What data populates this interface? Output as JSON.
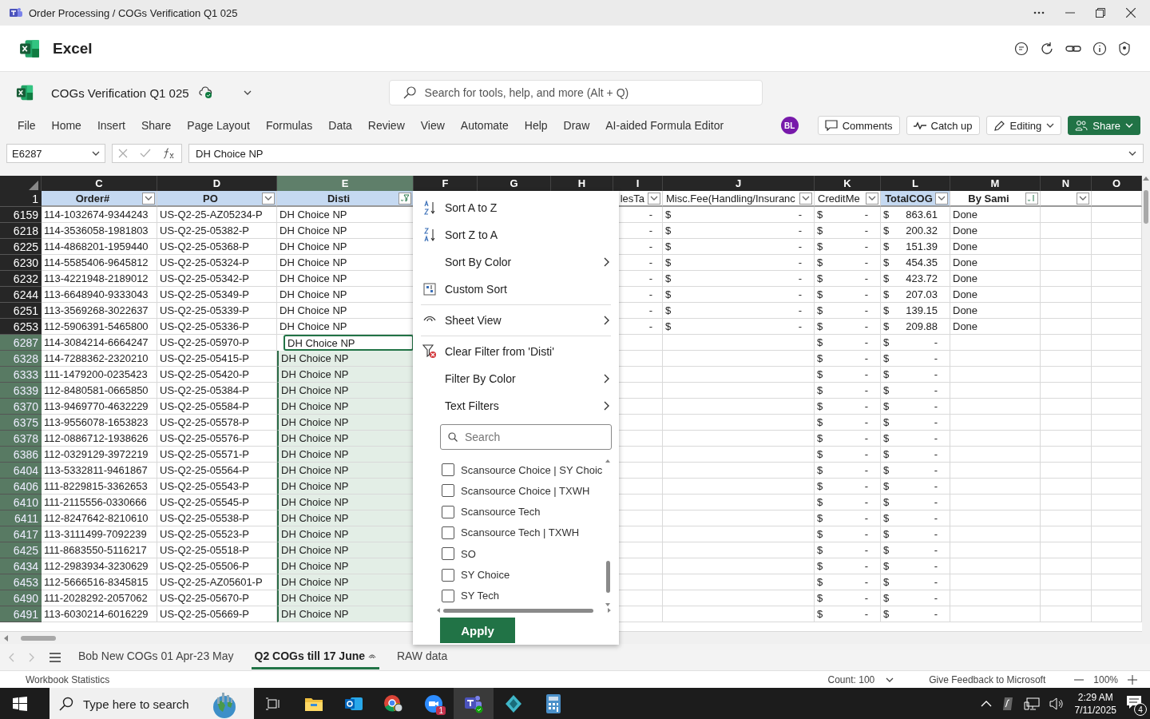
{
  "window": {
    "title": "Order Processing / COGs Verification Q1 025"
  },
  "app": {
    "name": "Excel"
  },
  "document": {
    "title": "COGs Verification Q1 025"
  },
  "search": {
    "placeholder": "Search for tools, help, and more (Alt + Q)"
  },
  "ribbon_tabs": [
    "File",
    "Home",
    "Insert",
    "Share",
    "Page Layout",
    "Formulas",
    "Data",
    "Review",
    "View",
    "Automate",
    "Help",
    "Draw",
    "AI-aided Formula Editor"
  ],
  "avatar": "BL",
  "actions": [
    {
      "kind": "comments",
      "label": "Comments"
    },
    {
      "kind": "catchup",
      "label": "Catch up"
    },
    {
      "kind": "editing",
      "label": "Editing"
    },
    {
      "kind": "share",
      "label": "Share"
    }
  ],
  "formula_bar": {
    "name_box": "E6287",
    "value": "DH Choice NP"
  },
  "header_row_number": "1",
  "columns": [
    {
      "letter": "C",
      "selected": false,
      "field": {
        "label": "Order#",
        "bold": true,
        "highlight": true,
        "kind": "dropdown"
      }
    },
    {
      "letter": "D",
      "selected": false,
      "field": {
        "label": "PO",
        "bold": true,
        "highlight": true,
        "kind": "dropdown"
      }
    },
    {
      "letter": "E",
      "selected": true,
      "field": {
        "label": "Disti",
        "bold": true,
        "highlight": true,
        "kind": "filtered"
      }
    },
    {
      "letter": "F",
      "selected": false
    },
    {
      "letter": "G",
      "selected": false
    },
    {
      "letter": "H",
      "selected": false
    },
    {
      "letter": "I",
      "selected": false,
      "field": {
        "label": "lesTa",
        "bold": false,
        "highlight": false,
        "kind": "dropdown"
      }
    },
    {
      "letter": "J",
      "selected": false,
      "field": {
        "label": "Misc.Fee(Handling/Insuranc",
        "bold": false,
        "highlight": false,
        "kind": "dropdown"
      }
    },
    {
      "letter": "K",
      "selected": false,
      "field": {
        "label": "CreditMe",
        "bold": false,
        "highlight": false,
        "kind": "dropdown"
      }
    },
    {
      "letter": "L",
      "selected": false,
      "field": {
        "label": "TotalCOG",
        "bold": true,
        "highlight": true,
        "kind": "dropdown"
      }
    },
    {
      "letter": "M",
      "selected": false,
      "field": {
        "label": "By Sami",
        "bold": true,
        "highlight": false,
        "kind": "sorted"
      }
    },
    {
      "letter": "N",
      "selected": false,
      "field": {
        "kind": "dropdown"
      }
    },
    {
      "letter": "O",
      "selected": false
    }
  ],
  "rows": [
    {
      "row": "6159",
      "selected": false,
      "active": false,
      "order": "114-1032674-9344243",
      "po": "US-Q2-25-AZ05234-P",
      "disti": "DH Choice NP",
      "i": "-",
      "j": [
        "$",
        "-"
      ],
      "k": [
        "$",
        "-"
      ],
      "l": [
        "$",
        "863.61"
      ],
      "m": "Done"
    },
    {
      "row": "6218",
      "selected": false,
      "active": false,
      "order": "114-3536058-1981803",
      "po": "US-Q2-25-05382-P",
      "disti": "DH Choice NP",
      "i": "-",
      "j": [
        "$",
        "-"
      ],
      "k": [
        "$",
        "-"
      ],
      "l": [
        "$",
        "200.32"
      ],
      "m": "Done"
    },
    {
      "row": "6225",
      "selected": false,
      "active": false,
      "order": "114-4868201-1959440",
      "po": "US-Q2-25-05368-P",
      "disti": "DH Choice NP",
      "i": "-",
      "j": [
        "$",
        "-"
      ],
      "k": [
        "$",
        "-"
      ],
      "l": [
        "$",
        "151.39"
      ],
      "m": "Done"
    },
    {
      "row": "6230",
      "selected": false,
      "active": false,
      "order": "114-5585406-9645812",
      "po": "US-Q2-25-05324-P",
      "disti": "DH Choice NP",
      "i": "-",
      "j": [
        "$",
        "-"
      ],
      "k": [
        "$",
        "-"
      ],
      "l": [
        "$",
        "454.35"
      ],
      "m": "Done"
    },
    {
      "row": "6232",
      "selected": false,
      "active": false,
      "order": "113-4221948-2189012",
      "po": "US-Q2-25-05342-P",
      "disti": "DH Choice NP",
      "i": "-",
      "j": [
        "$",
        "-"
      ],
      "k": [
        "$",
        "-"
      ],
      "l": [
        "$",
        "423.72"
      ],
      "m": "Done"
    },
    {
      "row": "6244",
      "selected": false,
      "active": false,
      "order": "113-6648940-9333043",
      "po": "US-Q2-25-05349-P",
      "disti": "DH Choice NP",
      "i": "-",
      "j": [
        "$",
        "-"
      ],
      "k": [
        "$",
        "-"
      ],
      "l": [
        "$",
        "207.03"
      ],
      "m": "Done"
    },
    {
      "row": "6251",
      "selected": false,
      "active": false,
      "order": "113-3569268-3022637",
      "po": "US-Q2-25-05339-P",
      "disti": "DH Choice NP",
      "i": "-",
      "j": [
        "$",
        "-"
      ],
      "k": [
        "$",
        "-"
      ],
      "l": [
        "$",
        "139.15"
      ],
      "m": "Done"
    },
    {
      "row": "6253",
      "selected": false,
      "active": false,
      "order": "112-5906391-5465800",
      "po": "US-Q2-25-05336-P",
      "disti": "DH Choice NP",
      "i": "-",
      "j": [
        "$",
        "-"
      ],
      "k": [
        "$",
        "-"
      ],
      "l": [
        "$",
        "209.88"
      ],
      "m": "Done"
    },
    {
      "row": "6287",
      "selected": true,
      "active": true,
      "order": "114-3084214-6664247",
      "po": "US-Q2-25-05970-P",
      "disti": "DH Choice NP",
      "k": [
        "$",
        "-"
      ],
      "l": [
        "$",
        "-"
      ]
    },
    {
      "row": "6328",
      "selected": true,
      "active": false,
      "order": "114-7288362-2320210",
      "po": "US-Q2-25-05415-P",
      "disti": "DH Choice NP",
      "k": [
        "$",
        "-"
      ],
      "l": [
        "$",
        "-"
      ]
    },
    {
      "row": "6333",
      "selected": true,
      "active": false,
      "order": "111-1479200-0235423",
      "po": "US-Q2-25-05420-P",
      "disti": "DH Choice NP",
      "k": [
        "$",
        "-"
      ],
      "l": [
        "$",
        "-"
      ]
    },
    {
      "row": "6339",
      "selected": true,
      "active": false,
      "order": "112-8480581-0665850",
      "po": "US-Q2-25-05384-P",
      "disti": "DH Choice NP",
      "k": [
        "$",
        "-"
      ],
      "l": [
        "$",
        "-"
      ]
    },
    {
      "row": "6370",
      "selected": true,
      "active": false,
      "order": "113-9469770-4632229",
      "po": "US-Q2-25-05584-P",
      "disti": "DH Choice NP",
      "k": [
        "$",
        "-"
      ],
      "l": [
        "$",
        "-"
      ]
    },
    {
      "row": "6375",
      "selected": true,
      "active": false,
      "order": "113-9556078-1653823",
      "po": "US-Q2-25-05578-P",
      "disti": "DH Choice NP",
      "k": [
        "$",
        "-"
      ],
      "l": [
        "$",
        "-"
      ]
    },
    {
      "row": "6378",
      "selected": true,
      "active": false,
      "order": "112-0886712-1938626",
      "po": "US-Q2-25-05576-P",
      "disti": "DH Choice NP",
      "k": [
        "$",
        "-"
      ],
      "l": [
        "$",
        "-"
      ]
    },
    {
      "row": "6386",
      "selected": true,
      "active": false,
      "order": "112-0329129-3972219",
      "po": "US-Q2-25-05571-P",
      "disti": "DH Choice NP",
      "k": [
        "$",
        "-"
      ],
      "l": [
        "$",
        "-"
      ]
    },
    {
      "row": "6404",
      "selected": true,
      "active": false,
      "order": "113-5332811-9461867",
      "po": "US-Q2-25-05564-P",
      "disti": "DH Choice NP",
      "k": [
        "$",
        "-"
      ],
      "l": [
        "$",
        "-"
      ]
    },
    {
      "row": "6406",
      "selected": true,
      "active": false,
      "order": "111-8229815-3362653",
      "po": "US-Q2-25-05543-P",
      "disti": "DH Choice NP",
      "k": [
        "$",
        "-"
      ],
      "l": [
        "$",
        "-"
      ]
    },
    {
      "row": "6410",
      "selected": true,
      "active": false,
      "order": "111-2115556-0330666",
      "po": "US-Q2-25-05545-P",
      "disti": "DH Choice NP",
      "k": [
        "$",
        "-"
      ],
      "l": [
        "$",
        "-"
      ]
    },
    {
      "row": "6411",
      "selected": true,
      "active": false,
      "order": "112-8247642-8210610",
      "po": "US-Q2-25-05538-P",
      "disti": "DH Choice NP",
      "k": [
        "$",
        "-"
      ],
      "l": [
        "$",
        "-"
      ]
    },
    {
      "row": "6417",
      "selected": true,
      "active": false,
      "order": "113-3111499-7092239",
      "po": "US-Q2-25-05523-P",
      "disti": "DH Choice NP",
      "k": [
        "$",
        "-"
      ],
      "l": [
        "$",
        "-"
      ]
    },
    {
      "row": "6425",
      "selected": true,
      "active": false,
      "order": "111-8683550-5116217",
      "po": "US-Q2-25-05518-P",
      "disti": "DH Choice NP",
      "k": [
        "$",
        "-"
      ],
      "l": [
        "$",
        "-"
      ]
    },
    {
      "row": "6434",
      "selected": true,
      "active": false,
      "order": "112-2983934-3230629",
      "po": "US-Q2-25-05506-P",
      "disti": "DH Choice NP",
      "k": [
        "$",
        "-"
      ],
      "l": [
        "$",
        "-"
      ]
    },
    {
      "row": "6453",
      "selected": true,
      "active": false,
      "order": "112-5666516-8345815",
      "po": "US-Q2-25-AZ05601-P",
      "disti": "DH Choice NP",
      "k": [
        "$",
        "-"
      ],
      "l": [
        "$",
        "-"
      ]
    },
    {
      "row": "6490",
      "selected": true,
      "active": false,
      "order": "111-2028292-2057062",
      "po": "US-Q2-25-05670-P",
      "disti": "DH Choice NP",
      "k": [
        "$",
        "-"
      ],
      "l": [
        "$",
        "-"
      ]
    },
    {
      "row": "6491",
      "selected": true,
      "active": false,
      "order": "113-6030214-6016229",
      "po": "US-Q2-25-05669-P",
      "disti": "DH Choice NP",
      "k": [
        "$",
        "-"
      ],
      "l": [
        "$",
        "-"
      ]
    }
  ],
  "filter_menu": {
    "items": [
      {
        "kind": "sort-asc",
        "label": "Sort A to Z"
      },
      {
        "kind": "sort-desc",
        "label": "Sort Z to A"
      },
      {
        "kind": "submenu",
        "label": "Sort By Color"
      },
      {
        "kind": "custom-sort",
        "label": "Custom Sort"
      },
      {
        "kind": "divider"
      },
      {
        "kind": "sheet-view",
        "label": "Sheet View"
      },
      {
        "kind": "divider"
      },
      {
        "kind": "clear-filter",
        "label": "Clear Filter from 'Disti'"
      },
      {
        "kind": "submenu",
        "label": "Filter By Color"
      },
      {
        "kind": "submenu",
        "label": "Text Filters"
      }
    ],
    "search_placeholder": "Search",
    "values": [
      {
        "label": "Scansource Choice | SY Choic",
        "checked": false
      },
      {
        "label": "Scansource Choice | TXWH",
        "checked": false
      },
      {
        "label": "Scansource Tech",
        "checked": false
      },
      {
        "label": "Scansource Tech | TXWH",
        "checked": false
      },
      {
        "label": "SO",
        "checked": false
      },
      {
        "label": "SY Choice",
        "checked": false
      },
      {
        "label": "SY Tech",
        "checked": false
      }
    ],
    "apply": "Apply"
  },
  "sheet_tabs": [
    {
      "label": "Bob New COGs 01 Apr-23 May",
      "selected": false
    },
    {
      "label": "Q2 COGs till 17 June",
      "selected": true
    },
    {
      "label": "RAW data",
      "selected": false
    }
  ],
  "status_bar": {
    "left": "Workbook Statistics",
    "count": "Count: 100",
    "feedback": "Give Feedback to Microsoft",
    "zoom": "100%"
  },
  "taskbar": {
    "search_placeholder": "Type here to search",
    "zoom_badge": "1",
    "time": "2:29 AM",
    "date": "7/11/2025",
    "notifications": "4"
  }
}
